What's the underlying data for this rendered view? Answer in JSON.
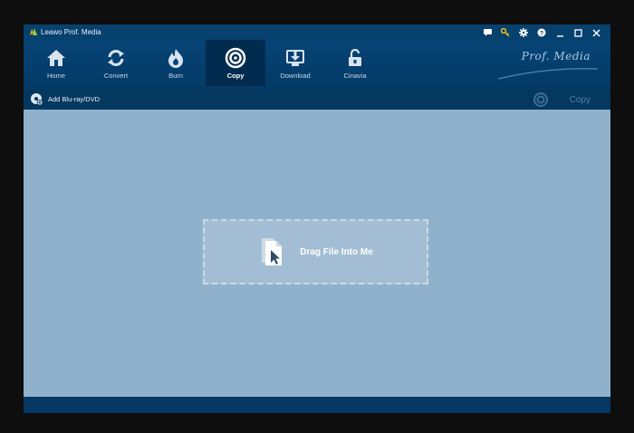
{
  "window": {
    "title": "Leawo Prof. Media"
  },
  "title_icons": [
    "chat-icon",
    "key-icon",
    "gear-icon",
    "help-icon",
    "minimize-icon",
    "maximize-icon",
    "close-icon"
  ],
  "toolbar": {
    "items": [
      {
        "label": "Home",
        "icon": "home-icon"
      },
      {
        "label": "Convert",
        "icon": "convert-icon"
      },
      {
        "label": "Burn",
        "icon": "burn-icon"
      },
      {
        "label": "Copy",
        "icon": "copy-disc-icon",
        "active": true
      },
      {
        "label": "Download",
        "icon": "download-icon"
      },
      {
        "label": "Cinavia",
        "icon": "cinavia-lock-icon"
      }
    ],
    "brand": "Prof. Media"
  },
  "subbar": {
    "add_label": "Add Blu-ray/DVD",
    "copy_label": "Copy"
  },
  "dropzone": {
    "text": "Drag File Into Me"
  },
  "colors": {
    "titlebar": "#07416e",
    "toolbar": "#064476",
    "active_tab": "#022c4f",
    "workspace": "#8fb1cb",
    "statusbar": "#053763"
  }
}
